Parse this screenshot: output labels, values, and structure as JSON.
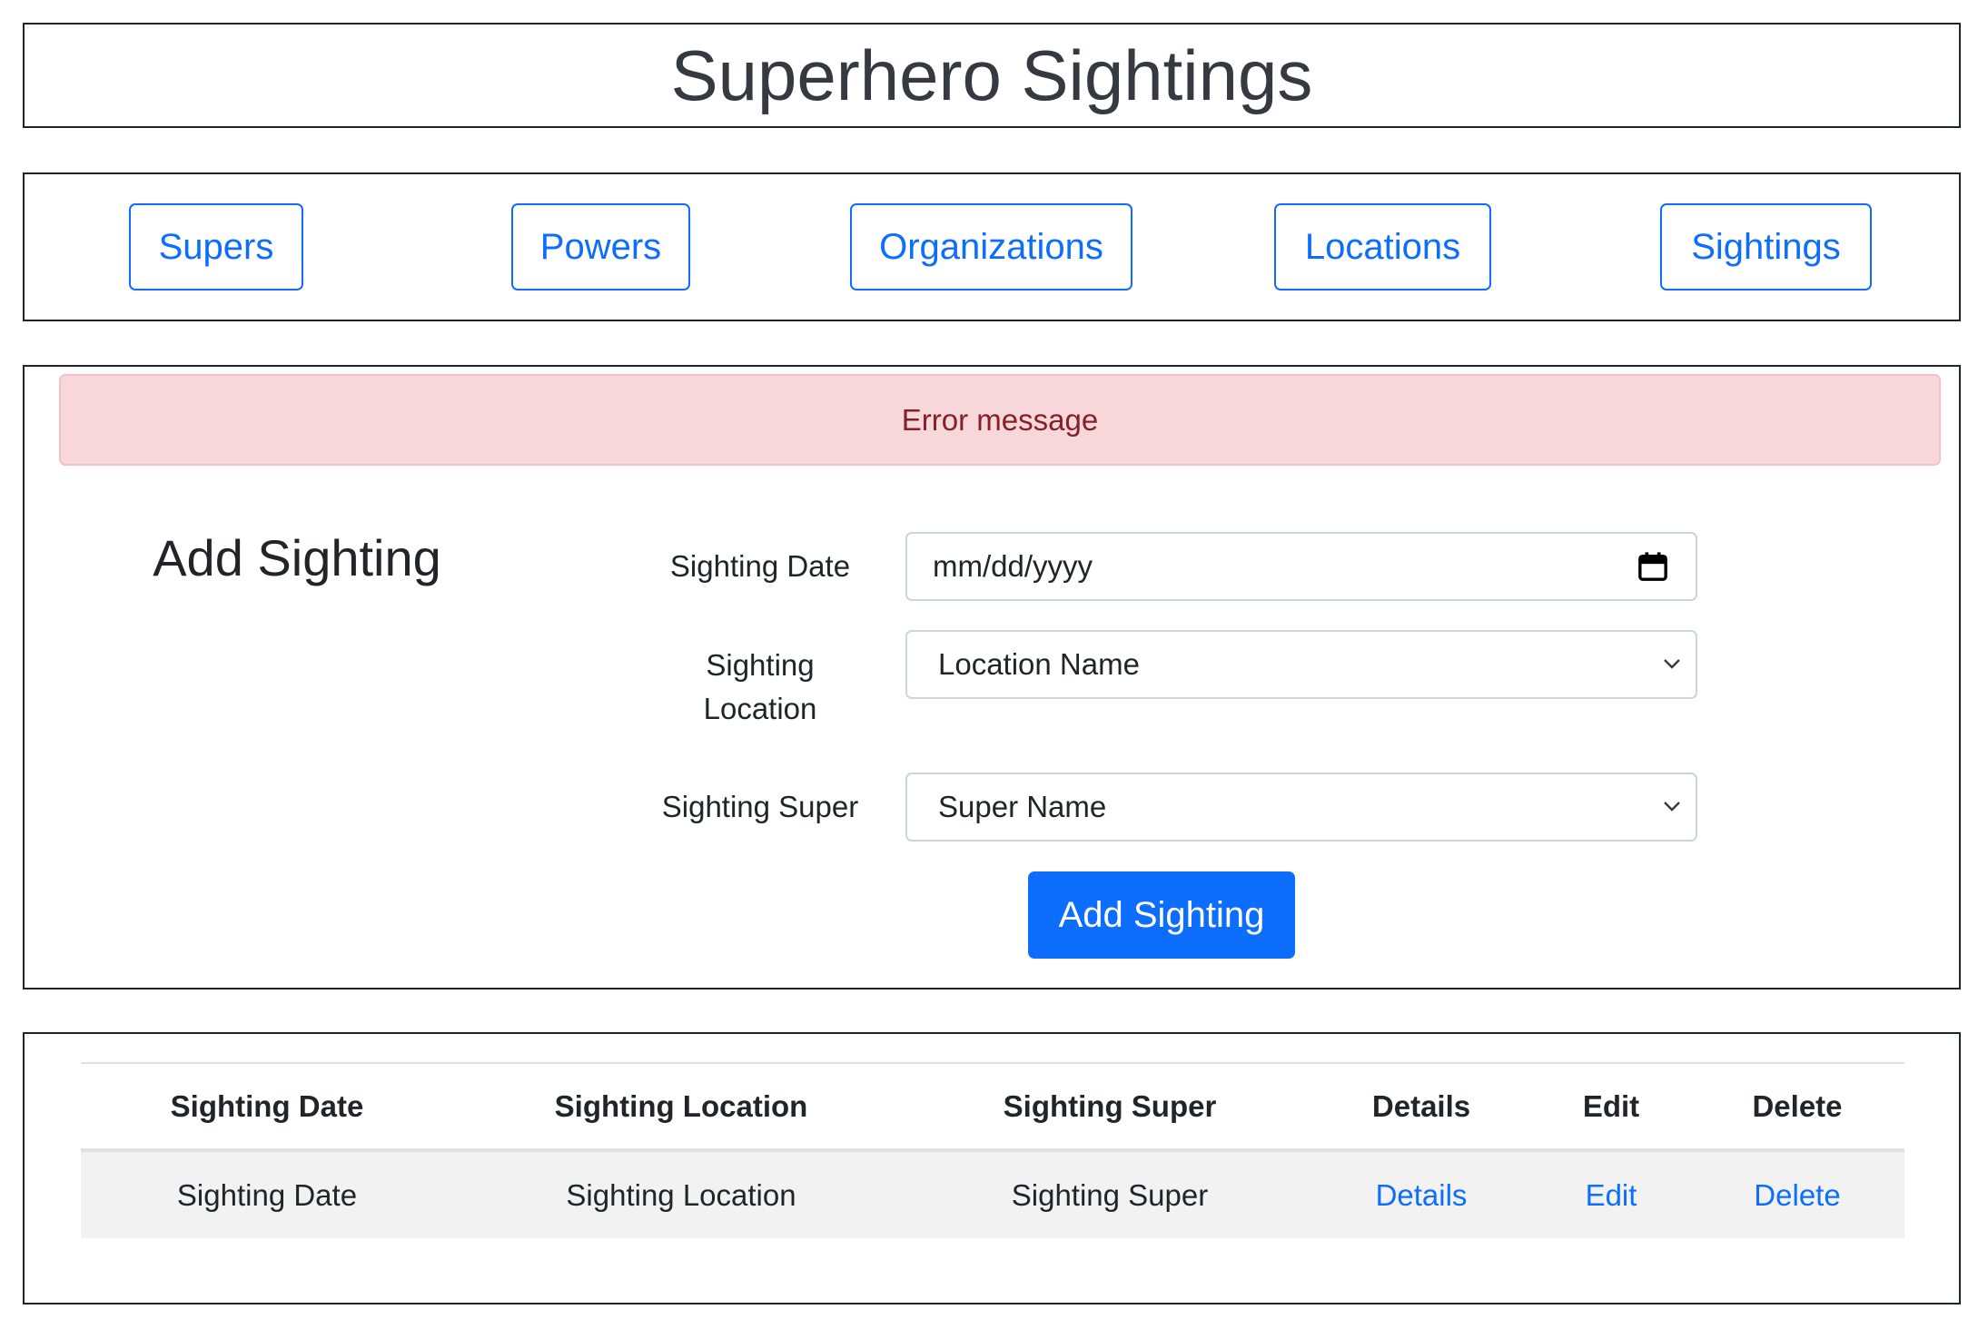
{
  "header": {
    "title": "Superhero Sightings"
  },
  "nav": {
    "items": [
      {
        "label": "Supers"
      },
      {
        "label": "Powers"
      },
      {
        "label": "Organizations"
      },
      {
        "label": "Locations"
      },
      {
        "label": "Sightings"
      }
    ]
  },
  "alert": {
    "message": "Error message"
  },
  "form": {
    "heading": "Add Sighting",
    "date_label": "Sighting Date",
    "date_placeholder": "mm/dd/yyyy",
    "location_label_line1": "Sighting",
    "location_label_line2": "Location",
    "location_selected": "Location Name",
    "super_label": "Sighting Super",
    "super_selected": "Super Name",
    "submit_label": "Add Sighting"
  },
  "table": {
    "headers": [
      "Sighting Date",
      "Sighting Location",
      "Sighting Super",
      "Details",
      "Edit",
      "Delete"
    ],
    "rows": [
      {
        "date": "Sighting Date",
        "location": "Sighting Location",
        "super": "Sighting Super",
        "details": "Details",
        "edit": "Edit",
        "delete": "Delete"
      }
    ]
  },
  "colors": {
    "primary": "#0d6efd",
    "alert_bg": "#f8d7da",
    "alert_text": "#842029",
    "row_bg": "#f2f2f2"
  },
  "icons": {
    "date_input": "calendar-icon",
    "select": "chevron-down-icon"
  }
}
